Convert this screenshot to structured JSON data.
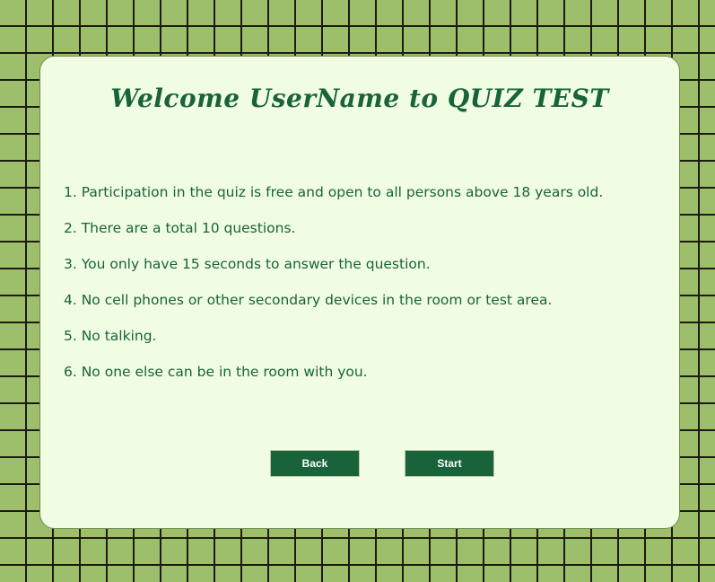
{
  "header": {
    "title": "Welcome UserName to QUIZ TEST"
  },
  "rules": [
    "1. Participation in the quiz is free and open to all persons above 18 years old.",
    "2. There are a total 10 questions.",
    "3. You only have 15 seconds to answer the question.",
    "4. No cell phones or other secondary devices in the room or test area.",
    "5. No talking.",
    "6. No one else can be in the room with you."
  ],
  "buttons": {
    "back_label": "Back",
    "start_label": "Start"
  },
  "colors": {
    "background_green": "#9dbe6a",
    "grid_line": "#1b1b12",
    "card_background": "#f1fde3",
    "text_green": "#186339",
    "button_green": "#186339",
    "button_text": "#ffffff"
  }
}
